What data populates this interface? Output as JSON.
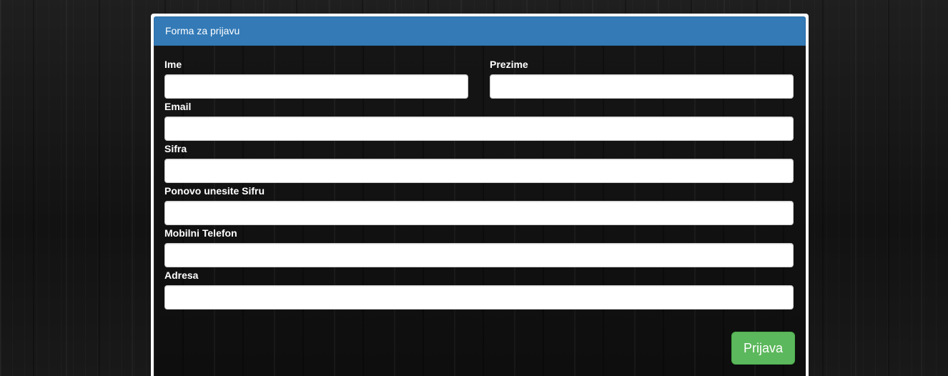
{
  "panel": {
    "title": "Forma za prijavu"
  },
  "form": {
    "fields": [
      {
        "label": "Ime",
        "value": "",
        "type": "text"
      },
      {
        "label": "Prezime",
        "value": "",
        "type": "text"
      },
      {
        "label": "Email",
        "value": "",
        "type": "email"
      },
      {
        "label": "Sifra",
        "value": "",
        "type": "password"
      },
      {
        "label": "Ponovo unesite Sifru",
        "value": "",
        "type": "password"
      },
      {
        "label": "Mobilni Telefon",
        "value": "",
        "type": "text"
      },
      {
        "label": "Adresa",
        "value": "",
        "type": "text"
      }
    ],
    "submit_label": "Prijava"
  },
  "colors": {
    "heading_background": "#337ab7",
    "submit_background": "#5cb85c",
    "page_background": "#161616"
  }
}
